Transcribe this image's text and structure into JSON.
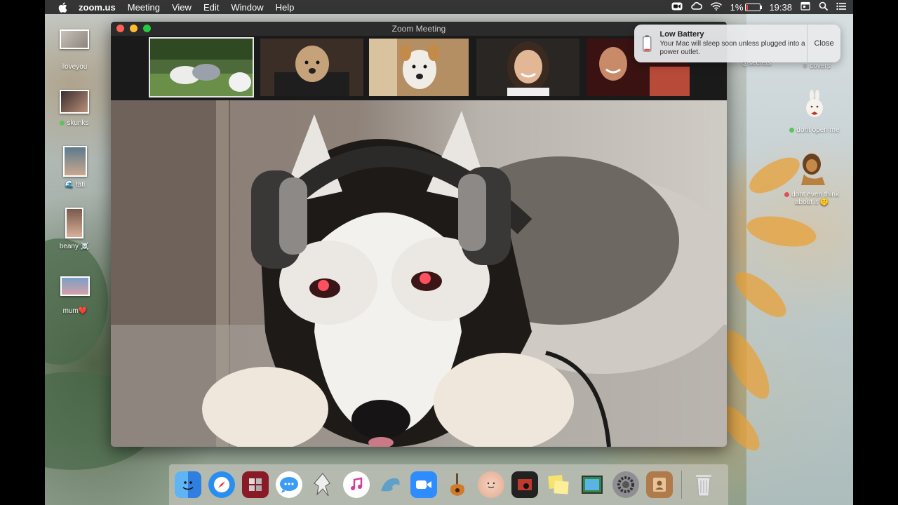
{
  "menubar": {
    "app_name": "zoom.us",
    "menus": [
      "Meeting",
      "View",
      "Edit",
      "Window",
      "Help"
    ],
    "battery_percent": "1%",
    "battery_level": 0.01,
    "clock": "19:38"
  },
  "window": {
    "title": "Zoom Meeting"
  },
  "participants": [
    {
      "icon": "dogs-in-garden-video"
    },
    {
      "icon": "poodle-on-chair-video"
    },
    {
      "icon": "terrier-dog-video"
    },
    {
      "icon": "smiling-woman-video"
    },
    {
      "icon": "smiling-man-video"
    }
  ],
  "active_speaker": {
    "icon": "husky-with-headphones-video"
  },
  "notification": {
    "title": "Low Battery",
    "message": "Your Mac will sleep soon unless plugged into a power outlet.",
    "close_label": "Close"
  },
  "desktop_icons_left": [
    {
      "label": "iloveyou"
    },
    {
      "label": "skunks",
      "tag_color": "#5ac45a"
    },
    {
      "label": "tati",
      "emoji": "🌊"
    },
    {
      "label": "beany",
      "emoji": "☠️"
    },
    {
      "label": "mum",
      "emoji": "❤️"
    }
  ],
  "desktop_icons_right": [
    {
      "label": "secrets",
      "emoji": "😗"
    },
    {
      "label": "covers"
    },
    {
      "label": "dont open me",
      "tag_color": "#5ac45a"
    },
    {
      "label": "dont even think about it",
      "emoji": "🤫",
      "tag_color": "#e0505a"
    }
  ],
  "dock_apps": [
    "finder-icon",
    "safari-icon",
    "photo-booth-icon",
    "messages-icon",
    "inkscape-icon",
    "itunes-icon",
    "mysql-workbench-icon",
    "zoom-icon",
    "garageband-icon",
    "memoji-icon",
    "photo-slideshow-icon",
    "stickies-icon",
    "preview-icon",
    "system-preferences-icon",
    "contacts-icon"
  ],
  "colors": {
    "menubar_bg": "#141414",
    "battery_low": "#ff453a",
    "titlebar": "#2b2b2b",
    "zoom_blue": "#2d8cff"
  }
}
